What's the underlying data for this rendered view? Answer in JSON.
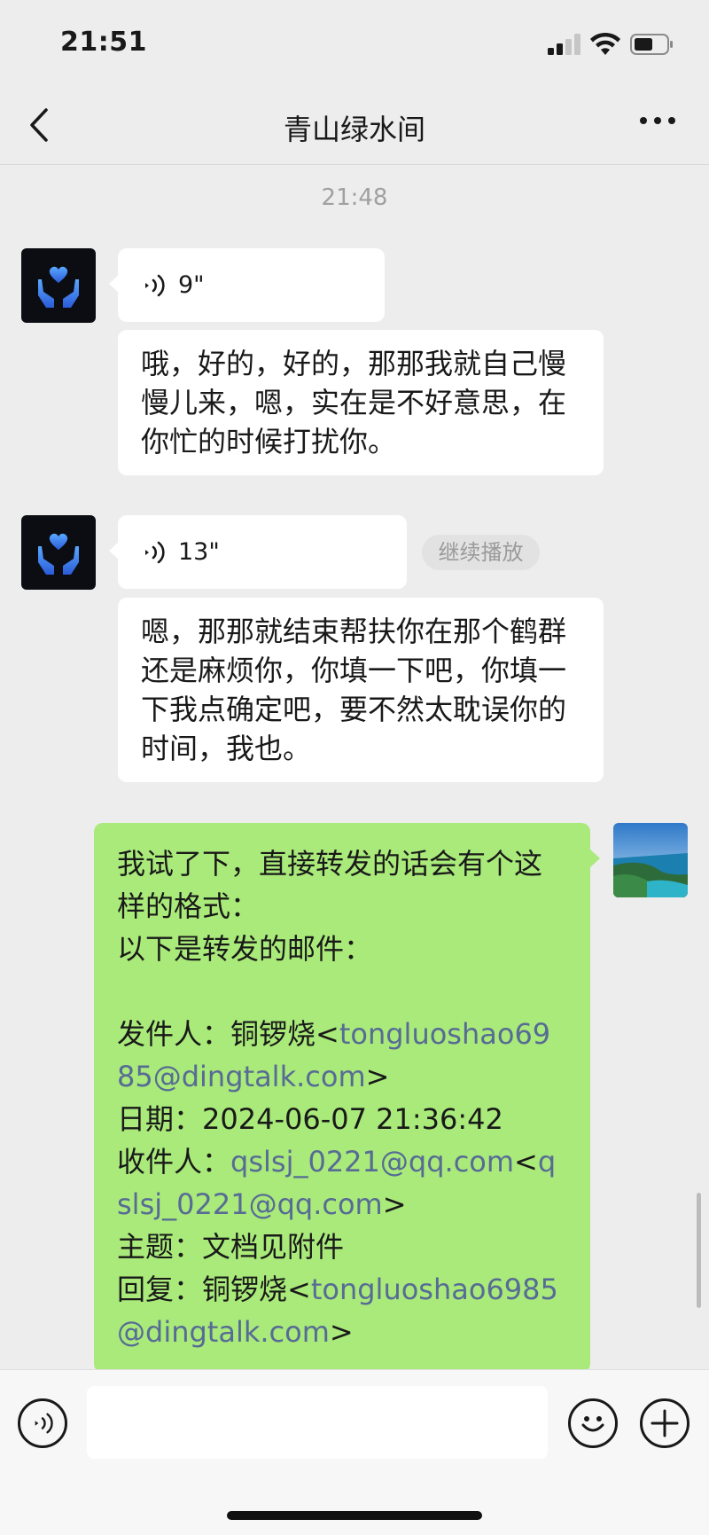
{
  "status_bar": {
    "time": "21:51"
  },
  "nav": {
    "title": "青山绿水间"
  },
  "timestamp": "21:48",
  "messages": [
    {
      "type": "voice",
      "side": "left",
      "duration": "9\""
    },
    {
      "type": "text",
      "side": "left",
      "text": "哦，好的，好的，那那我就自己慢慢儿来，嗯，实在是不好意思，在你忙的时候打扰你。"
    },
    {
      "type": "voice",
      "side": "left",
      "duration": "13\"",
      "action_label": "继续播放"
    },
    {
      "type": "text",
      "side": "left",
      "text": "嗯，那那就结束帮扶你在那个鹤群还是麻烦你，你填一下吧，你填一下我点确定吧，要不然太耽误你的时间，我也。"
    }
  ],
  "green_message": {
    "line1": "我试了下，直接转发的话会有个这样的格式：",
    "line2": "以下是转发的邮件：",
    "sender_label": "发件人：铜锣烧<",
    "sender_email": "tongluoshao6985@dingtalk.com",
    "sender_close": ">",
    "date_line": "日期：2024-06-07 21:36:42",
    "recipient_label": "收件人：",
    "recipient_email": "qslsj_0221@qq.com",
    "recipient_mid": "<",
    "recipient_email2": "qslsj_0221@qq.com",
    "recipient_close": ">",
    "subject_line": "主题：文档见附件",
    "reply_label": "回复：铜锣烧<",
    "reply_email": "tongluoshao6985@dingtalk.com",
    "reply_close": ">"
  },
  "colors": {
    "background": "#ededed",
    "green_bubble": "#a9ea7a",
    "link": "#576b95"
  },
  "icons": [
    "back-icon",
    "more-icon",
    "voice-icon",
    "emoji-icon",
    "plus-icon",
    "heart-hands-icon"
  ]
}
